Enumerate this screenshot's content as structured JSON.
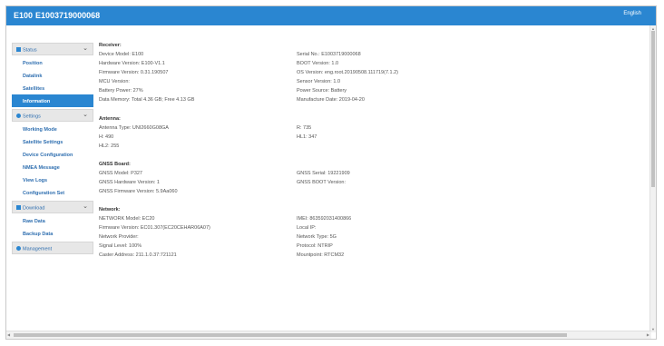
{
  "header": {
    "model": "E100",
    "serial": "E1003719000068",
    "language": "English"
  },
  "sidebar": {
    "status_label": "Status",
    "status_items": [
      "Position",
      "Datalink",
      "Satellites",
      "Information"
    ],
    "settings_label": "Settings",
    "settings_items": [
      "Working Mode",
      "Satellite Settings",
      "Device Configuration",
      "NMEA Message",
      "View Logs",
      "Configuration Set"
    ],
    "download_label": "Download",
    "download_items": [
      "Raw Data",
      "Backup Data"
    ],
    "management_label": "Management"
  },
  "receiver": {
    "title": "Receiver:",
    "device_model": "Device Model:  E100",
    "serial_no": "Serial No.:  E1003719000068",
    "hardware_version": "Hardware Version:  E100-V1.1",
    "boot_version": "BOOT Version:  1.0",
    "firmware_version": "Firmware Version:  0.31.190507",
    "os_version": "OS Version:  eng.root.20190508.111719(7.1.2)",
    "mcu_version": "MCU Version:",
    "sensor_version": "Sensor Version:  1.0",
    "battery_power": "Battery Power:  27%",
    "power_source": "Power Source:  Battery",
    "data_memory": "Data Memory:  Total 4.36 GB;  Free 4.13 GB",
    "manufacture_date": "Manufacture Date:  2019-04-20"
  },
  "antenna": {
    "title": "Antenna:",
    "antenna_type": "Antenna Type:  UNI2660G08GA",
    "r": "R:  735",
    "h": "H:  490",
    "hl1": "HL1:  347",
    "hl2": "HL2:  255"
  },
  "gnss": {
    "title": "GNSS Board:",
    "model": "GNSS Model:  P327",
    "serial": "GNSS Serial:  19221909",
    "hardware_version": "GNSS Hardware Version:  1",
    "boot_version": "GNSS BOOT Version:",
    "firmware_version": "GNSS Firmware Version:  5.9Aa060"
  },
  "network": {
    "title": "Network:",
    "model": "NETWORK Model:  EC20",
    "imei": "IMEI:  863592031400866",
    "firmware_version": "Firmware Version:  EC01.307(EC20CEHAR06A07)",
    "local_ip": "Local IP:",
    "provider": "Network Provider:",
    "network_type": "Network Type:  5G",
    "signal_level": "Signal Level:  100%",
    "protocol": "Protocol:  NTRIP",
    "caster_address": "Caster Address:  211.1.0.37:721121",
    "mountpoint": "Mountpoint:  RTCM32"
  }
}
